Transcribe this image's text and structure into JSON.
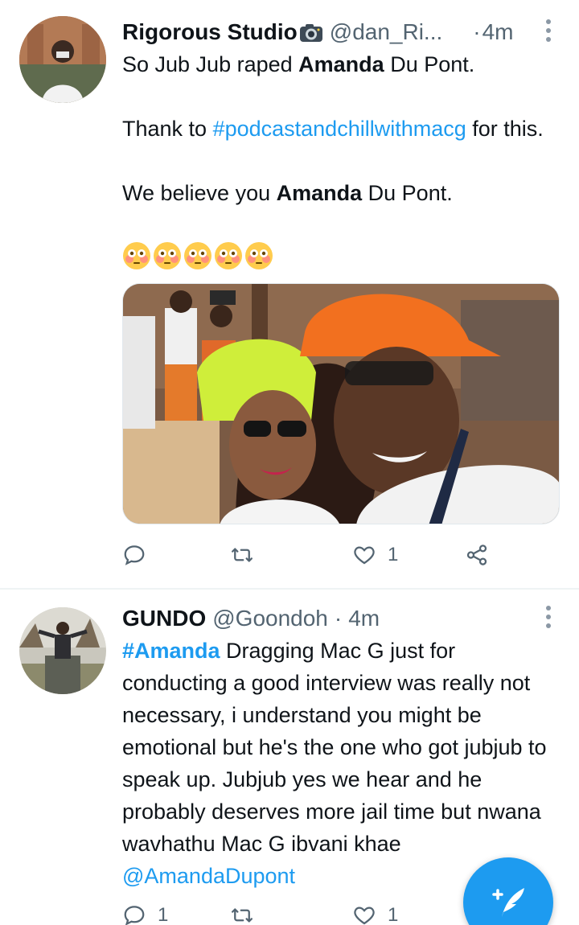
{
  "tweets": [
    {
      "name": "Rigorous Studio",
      "handle": "@dan_Ri...",
      "dot": "·",
      "time": "4m",
      "lines": {
        "l1a": "So Jub Jub raped ",
        "l1b": "Amanda",
        "l1c": " Du Pont.",
        "l2a": "Thank to ",
        "l2b": "#podcastandchillwithmacg",
        "l2c": " for this.",
        "l3a": "We believe you ",
        "l3b": "Amanda",
        "l3c": " Du Pont."
      },
      "emojis": [
        "flushed-face",
        "flushed-face",
        "flushed-face",
        "flushed-face",
        "flushed-face"
      ],
      "actions": {
        "reply": "",
        "retweet": "",
        "like": "1",
        "share": ""
      }
    },
    {
      "name": "GUNDO",
      "handle": "@Goondoh",
      "dot": "·",
      "time": "4m",
      "lines": {
        "tag": "#Amanda",
        "body": " Dragging Mac G just for conducting a good interview was really not necessary, i understand you might be emotional but he's the one who got jubjub to speak up. Jubjub yes we hear and he probably deserves more jail time but nwana wavhathu Mac G ibvani khae ",
        "mention": "@AmandaDupont"
      },
      "actions": {
        "reply": "1",
        "retweet": "",
        "like": "1",
        "share": ""
      }
    }
  ],
  "colors": {
    "accent": "#1d9bf0",
    "secondary_text": "#536471",
    "primary_text": "#0f1419"
  },
  "icons": [
    "camera-icon",
    "more-icon",
    "reply-icon",
    "retweet-icon",
    "like-icon",
    "share-icon",
    "compose-icon"
  ]
}
